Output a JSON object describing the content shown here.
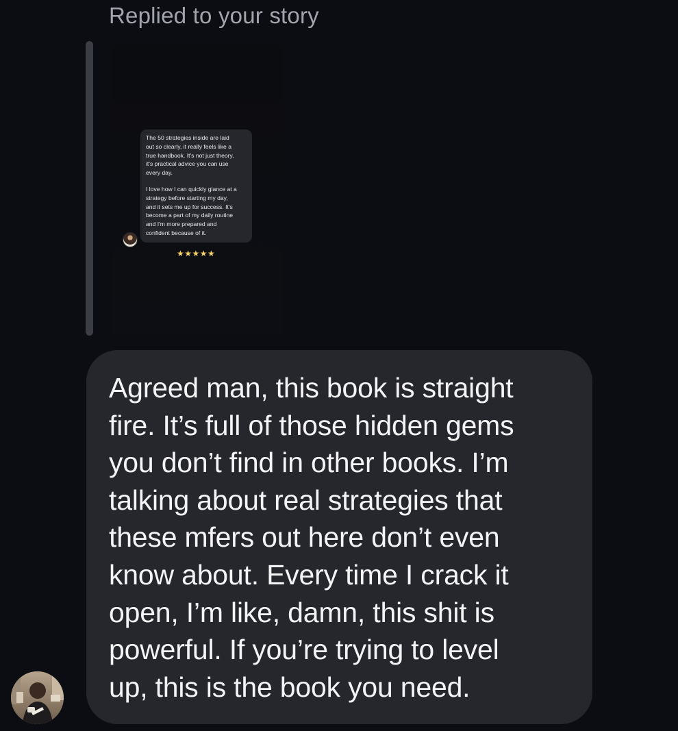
{
  "conversation": {
    "reply_context": "Replied to your story",
    "story": {
      "review_paragraphs": [
        "The 50 strategies inside are laid\nout so clearly, it really feels like a\ntrue handbook. It's not just theory,\nit's practical advice you can use\nevery day.",
        "I love how I can quickly glance at a\nstrategy before starting my day,\nand it sets me up for success. It's\nbecome a part of my daily routine\nand I'm more prepared and\nconfident because of it."
      ],
      "rating_stars": "★★★★★"
    },
    "message": {
      "text": "Agreed man, this book is straight\nfire. It’s full of those hidden gems\nyou don’t find in other books. I’m\ntalking about real strategies that\nthese mfers out here don’t even\nknow about. Every time I crack it\nopen, I’m like, damn, this shit is\npowerful. If you’re trying to level\nup, this is the book you need."
    }
  },
  "colors": {
    "background": "#0c0d12",
    "bubble": "#25272d",
    "quote_bar": "#3b3d44",
    "header_text": "#a2a5ad",
    "message_text": "#f4f4f6",
    "stars": "#f6d26b"
  }
}
